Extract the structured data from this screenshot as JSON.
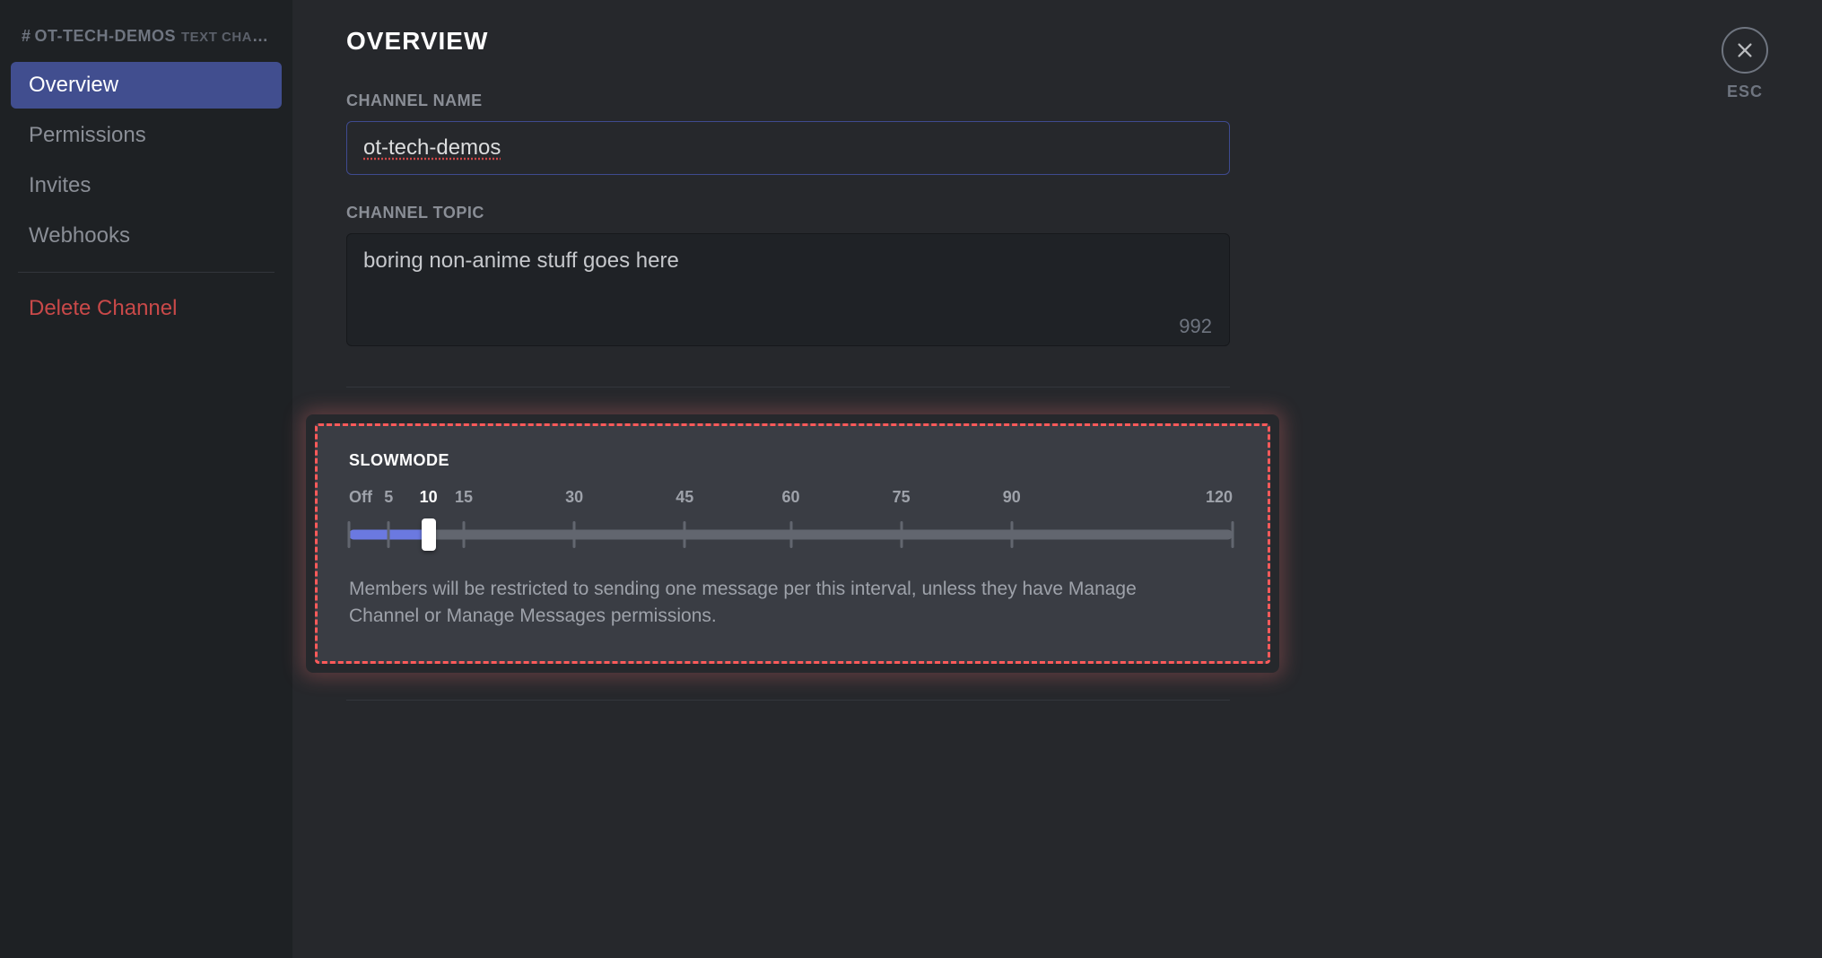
{
  "sidebar": {
    "channel_name_display": "OT-TECH-DEMOS",
    "channel_type": "TEXT CHAN…",
    "items": [
      {
        "label": "Overview",
        "active": true
      },
      {
        "label": "Permissions",
        "active": false
      },
      {
        "label": "Invites",
        "active": false
      },
      {
        "label": "Webhooks",
        "active": false
      }
    ],
    "delete_label": "Delete Channel"
  },
  "close": {
    "esc_label": "ESC"
  },
  "page": {
    "title": "OVERVIEW",
    "channel_name_label": "CHANNEL NAME",
    "channel_name_value": "ot-tech-demos",
    "channel_topic_label": "CHANNEL TOPIC",
    "channel_topic_value": "boring non-anime stuff goes here",
    "channel_topic_remaining": "992"
  },
  "slowmode": {
    "title": "SLOWMODE",
    "ticks": [
      {
        "label": "Off",
        "pos": 0.0
      },
      {
        "label": "5",
        "pos": 4.5
      },
      {
        "label": "10",
        "pos": 9.0
      },
      {
        "label": "15",
        "pos": 13.0
      },
      {
        "label": "30",
        "pos": 25.5
      },
      {
        "label": "45",
        "pos": 38.0
      },
      {
        "label": "60",
        "pos": 50.0
      },
      {
        "label": "75",
        "pos": 62.5
      },
      {
        "label": "90",
        "pos": 75.0
      },
      {
        "label": "120",
        "pos": 100.0
      }
    ],
    "value_label": "10",
    "value_pos": 9.0,
    "description": "Members will be restricted to sending one message per this interval, unless they have Manage Channel or Manage Messages permissions."
  }
}
